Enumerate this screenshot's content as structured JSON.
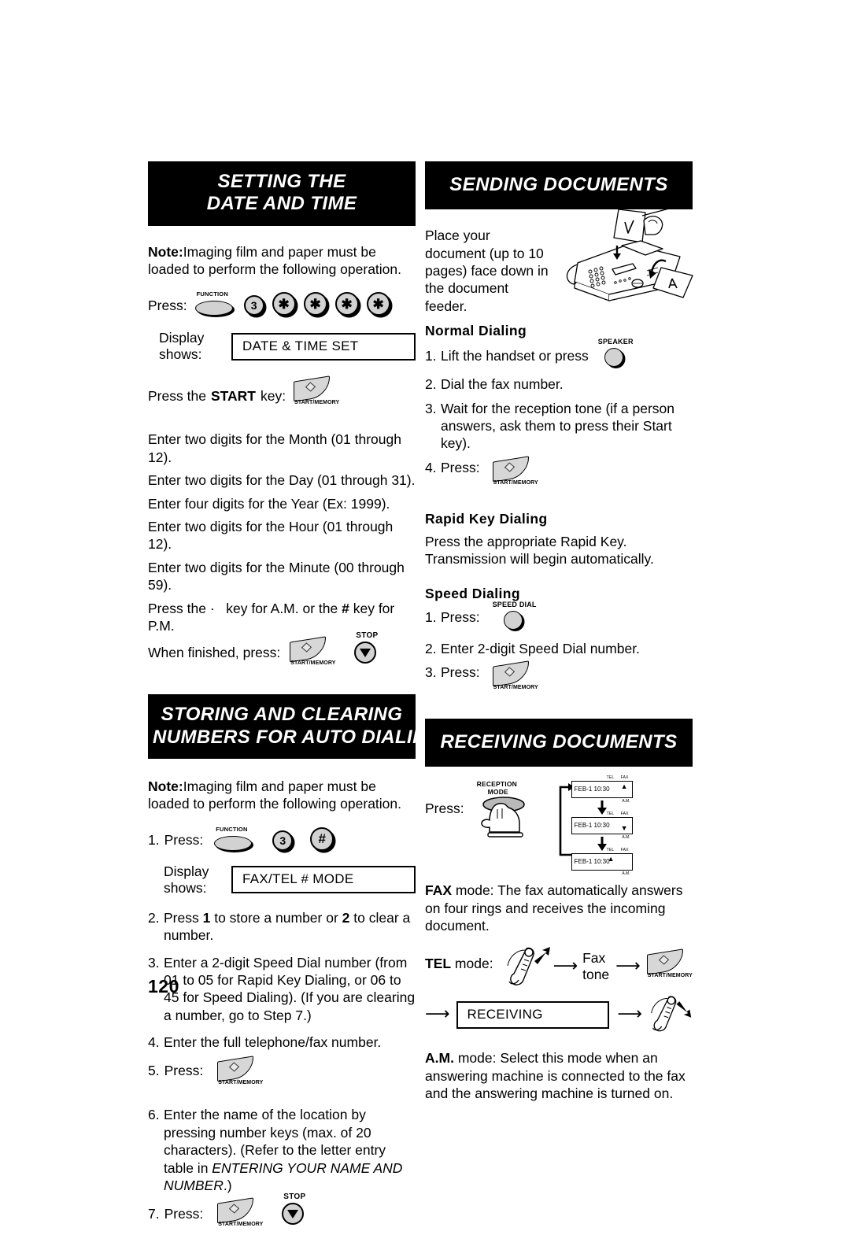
{
  "page": {
    "number": "120"
  },
  "sections": {
    "setting_date_time": {
      "banner_line1": "SETTING THE",
      "banner_line2": "DATE AND TIME",
      "note_label": "Note:",
      "note_text": "Imaging film and paper must be loaded to perform the following operation.",
      "press_label": "Press:",
      "keys": {
        "function": "FUNCTION",
        "digit": "3",
        "star": "✳",
        "star_count": "4"
      },
      "display_shows_label": "Display shows:",
      "display_value": "DATE & TIME SET",
      "press_start_pre": "Press the",
      "press_start_key": "START",
      "press_start_post": "key:",
      "start_key_caption": "START/MEMORY",
      "entry_lines": [
        "Enter two digits for the Month (01 through 12).",
        "Enter two digits for the Day (01 through 31).",
        "Enter four digits for the Year (Ex: 1999).",
        "Enter two digits for the Hour (01 through 12).",
        "Enter two digits for the Minute (00 through 59)."
      ],
      "am_pm_line_a": "Press the",
      "am_pm_dot": "·",
      "am_pm_line_b": "key for A.M. or the",
      "am_pm_hash": "#",
      "am_pm_line_c": "key for P.M.",
      "when_finished": "When finished, press:",
      "stop_key_caption": "STOP"
    },
    "storing_clearing": {
      "banner_line1": "STORING AND CLEARING",
      "banner_line2": "NUMBERS FOR AUTO DIALING",
      "note_label": "Note:",
      "note_text": "Imaging film and paper must be loaded to perform the following operation.",
      "step1_num": "1.",
      "step1_label": "Press:",
      "keys": {
        "function": "FUNCTION",
        "digit": "3",
        "hash": "#"
      },
      "display_shows_label": "Display shows:",
      "display_value": "FAX/TEL # MODE",
      "steps": [
        {
          "num": "2.",
          "parts": [
            {
              "t": "Press ",
              "b": false
            },
            {
              "t": "1",
              "b": true
            },
            {
              "t": " to store a number or ",
              "b": false
            },
            {
              "t": "2",
              "b": true
            },
            {
              "t": " to clear a number.",
              "b": false
            }
          ]
        },
        {
          "num": "3.",
          "parts": [
            {
              "t": "Enter a 2-digit Speed Dial number (from 01 to 05 for Rapid Key Dialing, or 06 to 45 for Speed Dialing).  (If you are clearing a number, go to Step 7.)",
              "b": false
            }
          ]
        },
        {
          "num": "4.",
          "parts": [
            {
              "t": "Enter the full telephone/fax number.",
              "b": false
            }
          ]
        }
      ],
      "step5_num": "5.",
      "step5_label": "Press:",
      "step6_num": "6.",
      "step6_text_a": "Enter the name of the location by pressing number keys (max. of 20 characters). (Refer to the letter entry table in ",
      "step6_text_italic": "ENTERING YOUR NAME AND NUMBER",
      "step6_text_b": ".)",
      "step7_num": "7.",
      "step7_label": "Press:",
      "start_key_caption": "START/MEMORY",
      "stop_key_caption": "STOP"
    },
    "sending_documents": {
      "banner": "SENDING DOCUMENTS",
      "intro": "Place your document (up to 10 pages) face down in the document feeder.",
      "fax_illustration_name": "fax-machine-loading-illustration",
      "normal_dialing": {
        "heading": "Normal  Dialing",
        "steps": [
          {
            "num": "1.",
            "text": "Lift the handset or press"
          },
          {
            "num": "2.",
            "text": "Dial the fax number."
          },
          {
            "num": "3.",
            "text": "Wait for the reception tone (if a person answers, ask them to press their Start key)."
          },
          {
            "num": "4.",
            "text": "Press:"
          }
        ],
        "speaker_key_caption": "SPEAKER",
        "start_key_caption": "START/MEMORY"
      },
      "rapid_key_dialing": {
        "heading": "Rapid  Key  Dialing",
        "text": "Press the appropriate Rapid Key.  Transmission will begin automatically."
      },
      "speed_dialing": {
        "heading": "Speed  Dialing",
        "steps": [
          {
            "num": "1.",
            "text": "Press:"
          },
          {
            "num": "2.",
            "text": "Enter 2-digit Speed Dial number."
          },
          {
            "num": "3.",
            "text": "Press:"
          }
        ],
        "speed_dial_key_caption": "SPEED DIAL",
        "start_key_caption": "START/MEMORY"
      }
    },
    "receiving_documents": {
      "banner": "RECEIVING DOCUMENTS",
      "press_label": "Press:",
      "reception_key_caption_line1": "RECEPTION",
      "reception_key_caption_line2": "MODE",
      "lcd_panels": [
        {
          "text": "FEB-1 10:30",
          "tel": "TEL",
          "fax": "FAX",
          "am": "A.M.",
          "marker": "▲",
          "marker_pos": "fax"
        },
        {
          "text": "FEB-1 10:30",
          "tel": "TEL",
          "fax": "FAX",
          "am": "A.M.",
          "marker": "▼",
          "marker_pos": "am"
        },
        {
          "text": "FEB-1 10:30",
          "tel": "TEL",
          "fax": "FAX",
          "am": "A.M.",
          "marker": "▲",
          "marker_pos": "tel"
        }
      ],
      "fax_mode_label": "FAX",
      "fax_mode_text": " mode: The fax automatically answers on four rings and receives the incoming document.",
      "tel_mode_label": "TEL",
      "tel_mode_text": " mode:",
      "tel_flow": {
        "fax_line1": "Fax",
        "fax_line2": "tone",
        "start_key_caption": "START/MEMORY",
        "receiving_display": "RECEIVING"
      },
      "am_mode_label": "A.M.",
      "am_mode_text": " mode: Select this mode when an answering machine is connected to the fax and the answering machine is turned on."
    }
  }
}
